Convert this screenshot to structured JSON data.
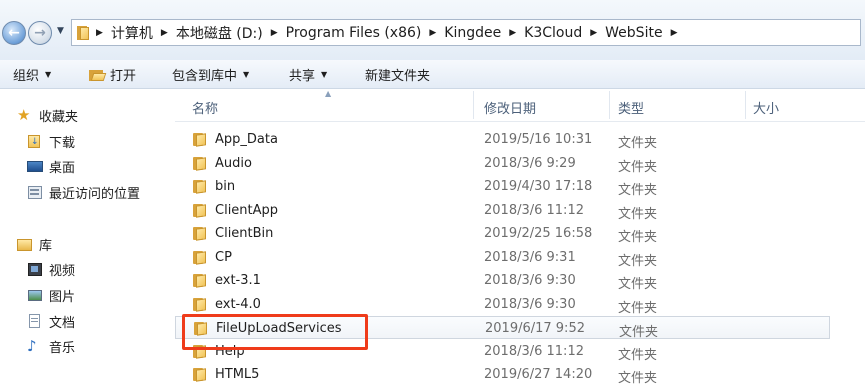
{
  "address_bar": {
    "crumbs": [
      "计算机",
      "本地磁盘 (D:)",
      "Program Files (x86)",
      "Kingdee",
      "K3Cloud",
      "WebSite"
    ]
  },
  "toolbar": {
    "organize": "组织",
    "open": "打开",
    "include_in_library": "包含到库中",
    "share": "共享",
    "new_folder": "新建文件夹"
  },
  "nav": {
    "favorites": "收藏夹",
    "downloads": "下载",
    "desktop": "桌面",
    "recent": "最近访问的位置",
    "libraries": "库",
    "videos": "视频",
    "pictures": "图片",
    "documents": "文档",
    "music": "音乐"
  },
  "columns": {
    "name": "名称",
    "date": "修改日期",
    "type": "类型",
    "size": "大小"
  },
  "files": [
    {
      "name": "App_Data",
      "date": "2019/5/16 10:31",
      "type": "文件夹"
    },
    {
      "name": "Audio",
      "date": "2018/3/6 9:29",
      "type": "文件夹"
    },
    {
      "name": "bin",
      "date": "2019/4/30 17:18",
      "type": "文件夹"
    },
    {
      "name": "ClientApp",
      "date": "2018/3/6 11:12",
      "type": "文件夹"
    },
    {
      "name": "ClientBin",
      "date": "2019/2/25 16:58",
      "type": "文件夹"
    },
    {
      "name": "CP",
      "date": "2018/3/6 9:31",
      "type": "文件夹"
    },
    {
      "name": "ext-3.1",
      "date": "2018/3/6 9:30",
      "type": "文件夹"
    },
    {
      "name": "ext-4.0",
      "date": "2018/3/6 9:30",
      "type": "文件夹"
    },
    {
      "name": "FileUpLoadServices",
      "date": "2019/6/17 9:52",
      "type": "文件夹"
    },
    {
      "name": "Help",
      "date": "2018/3/6 11:12",
      "type": "文件夹"
    },
    {
      "name": "HTML5",
      "date": "2019/6/27 14:20",
      "type": "文件夹"
    }
  ],
  "selected_index": 8,
  "colors": {
    "highlight": "#ef3b1a",
    "folder": "#f1c458",
    "header_text": "#4c607a"
  }
}
